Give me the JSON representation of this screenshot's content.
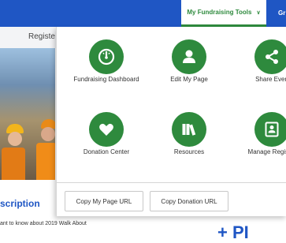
{
  "topbar": {
    "tools_tab": "My Fundraising Tools",
    "next_tab": "Gr"
  },
  "subnav": {
    "text": "Registe"
  },
  "dropdown": {
    "tiles": [
      {
        "label": "Fundraising Dashboard",
        "icon": "gauge-icon"
      },
      {
        "label": "Edit My Page",
        "icon": "person-icon"
      },
      {
        "label": "Share Even",
        "icon": "share-icon"
      },
      {
        "label": "Donation Center",
        "icon": "heart-icon"
      },
      {
        "label": "Resources",
        "icon": "books-icon"
      },
      {
        "label": "Manage Registra",
        "icon": "id-card-icon"
      }
    ],
    "buttons": {
      "copy_page_url": "Copy My Page URL",
      "copy_donation_url": "Copy Donation URL"
    }
  },
  "background": {
    "description_title": "scription",
    "description_text": "ant to know about 2019 Walk About",
    "big_text": "+ PI"
  },
  "colors": {
    "primary_blue": "#1f56c4",
    "accent_green": "#2e8a3d"
  }
}
